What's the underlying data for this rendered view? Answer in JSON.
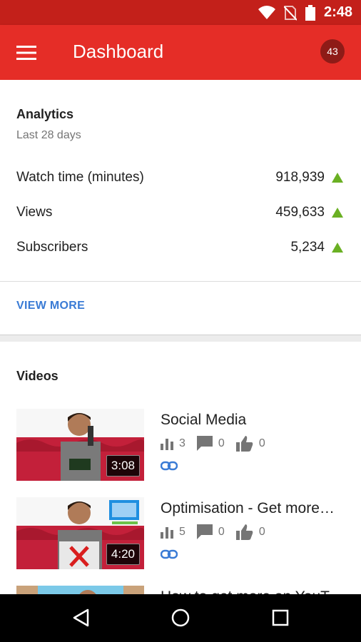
{
  "status_bar": {
    "time": "2:48",
    "icons": [
      "wifi-icon",
      "no-sim-icon",
      "battery-icon"
    ]
  },
  "app_bar": {
    "title": "Dashboard",
    "notification_count": "43",
    "color": "#e52d27"
  },
  "analytics": {
    "title": "Analytics",
    "subtitle": "Last 28 days",
    "stats": [
      {
        "label": "Watch time (minutes)",
        "value": "918,939",
        "trend": "up"
      },
      {
        "label": "Views",
        "value": "459,633",
        "trend": "up"
      },
      {
        "label": "Subscribers",
        "value": "5,234",
        "trend": "up"
      }
    ],
    "view_more": "VIEW MORE",
    "trend_color": "#6ab023",
    "link_color": "#3a7bd5"
  },
  "videos": {
    "title": "Videos",
    "items": [
      {
        "title": "Social Media",
        "duration": "3:08",
        "views": "3",
        "comments": "0",
        "likes": "0"
      },
      {
        "title": "Optimisation - Get more…",
        "duration": "4:20",
        "views": "5",
        "comments": "0",
        "likes": "0"
      },
      {
        "title": "How to get more on YouTube",
        "duration": "",
        "views": "",
        "comments": "",
        "likes": ""
      }
    ]
  },
  "nav": {
    "buttons": [
      "back-icon",
      "home-icon",
      "recents-icon"
    ]
  }
}
